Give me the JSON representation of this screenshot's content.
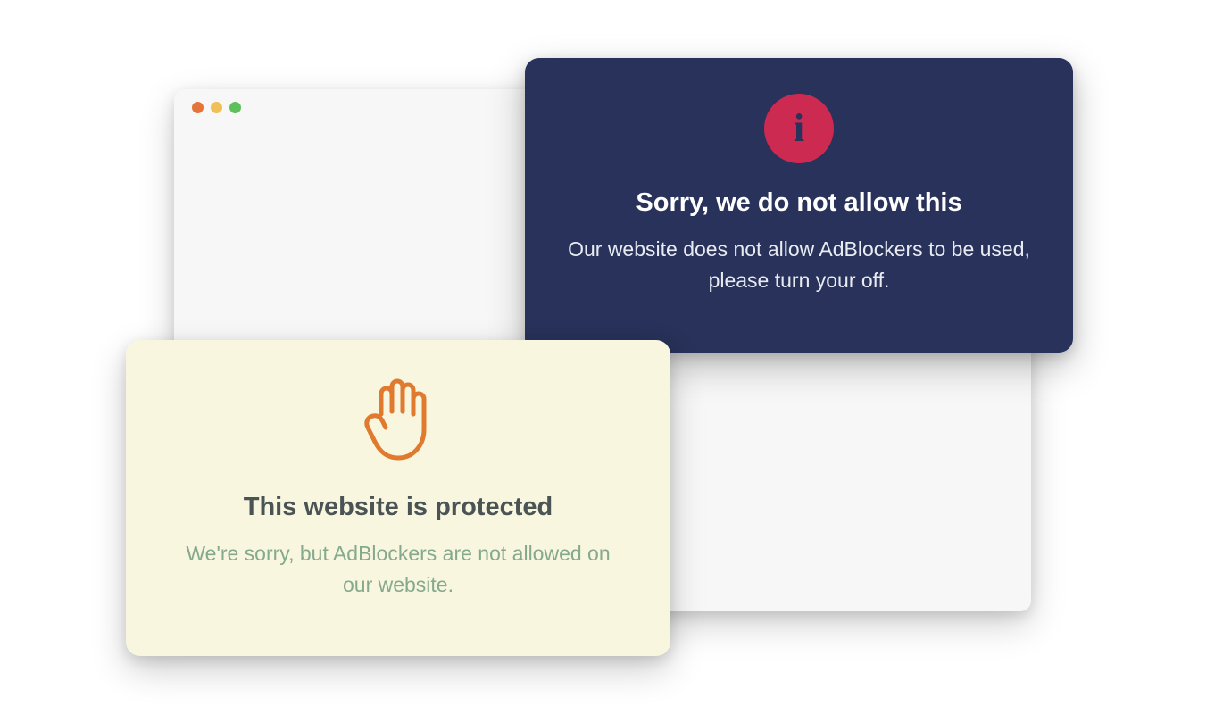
{
  "dark_card": {
    "icon": "info-icon",
    "title": "Sorry, we do not allow this",
    "body": "Our website does not allow AdBlockers to be used, please turn your off."
  },
  "light_card": {
    "icon": "hand-stop-icon",
    "title": "This website is protected",
    "body": "We're sorry, but AdBlockers are not allowed on our website."
  },
  "colors": {
    "dark_bg": "#28325a",
    "accent_red": "#cd2a52",
    "light_bg": "#f9f6e0",
    "hand_stroke": "#e07a2e",
    "light_text": "#84a98c"
  }
}
